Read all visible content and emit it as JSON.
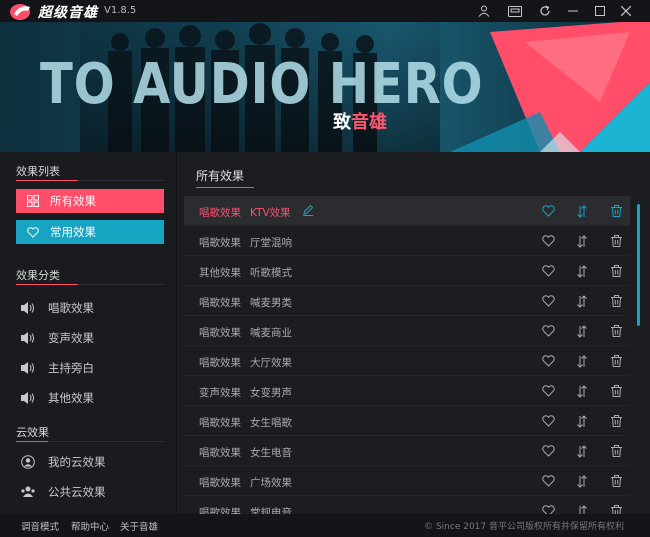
{
  "app": {
    "name": "超级音雄",
    "version": "V1.8.5"
  },
  "banner": {
    "title": "TO AUDIO HERO",
    "subtitle_prefix": "致",
    "subtitle_accent": "音雄"
  },
  "sidebar": {
    "effects_list_title": "效果列表",
    "all_effects_label": "所有效果",
    "common_effects_label": "常用效果",
    "categories_title": "效果分类",
    "categories": [
      {
        "label": "唱歌效果",
        "icon": "speaker-icon"
      },
      {
        "label": "变声效果",
        "icon": "speaker-icon"
      },
      {
        "label": "主持旁白",
        "icon": "speaker-icon"
      },
      {
        "label": "其他效果",
        "icon": "speaker-icon"
      }
    ],
    "cloud_title": "云效果",
    "cloud_items": [
      {
        "label": "我的云效果",
        "icon": "user-icon"
      },
      {
        "label": "公共云效果",
        "icon": "people-icon"
      }
    ]
  },
  "main": {
    "title": "所有效果",
    "rows": [
      {
        "category": "唱歌效果",
        "name": "KTV效果",
        "active": true
      },
      {
        "category": "唱歌效果",
        "name": "厅堂混响",
        "active": false
      },
      {
        "category": "其他效果",
        "name": "听歌模式",
        "active": false
      },
      {
        "category": "唱歌效果",
        "name": "喊麦男类",
        "active": false
      },
      {
        "category": "唱歌效果",
        "name": "喊麦商业",
        "active": false
      },
      {
        "category": "唱歌效果",
        "name": "大厅效果",
        "active": false
      },
      {
        "category": "变声效果",
        "name": "女变男声",
        "active": false
      },
      {
        "category": "唱歌效果",
        "name": "女生唱歌",
        "active": false
      },
      {
        "category": "唱歌效果",
        "name": "女生电音",
        "active": false
      },
      {
        "category": "唱歌效果",
        "name": "广场效果",
        "active": false
      },
      {
        "category": "唱歌效果",
        "name": "常规电音",
        "active": false
      }
    ]
  },
  "footer": {
    "links": [
      "调音模式",
      "帮助中心",
      "关于音雄"
    ],
    "copyright": "© Since 2017 音平公司版权所有并保留所有权利"
  },
  "colors": {
    "accent_pink": "#ff4d6a",
    "accent_cyan": "#17a3c2",
    "background": "#1a1b1e"
  }
}
